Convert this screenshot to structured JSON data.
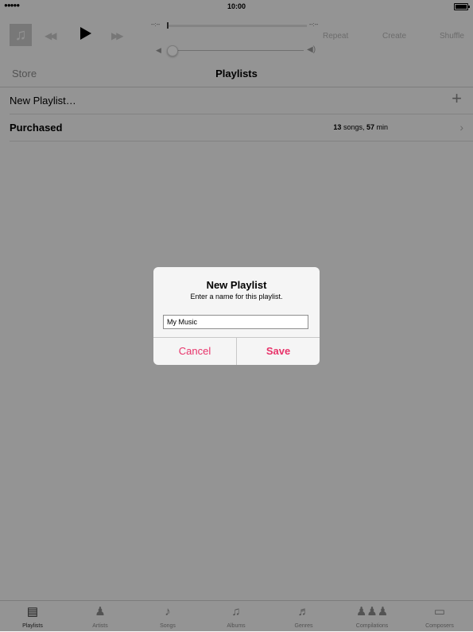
{
  "status_bar": {
    "signal": "●●●●●",
    "time": "10:00"
  },
  "player": {
    "elapsed": "--:--",
    "remaining": "--:--",
    "repeat_label": "Repeat",
    "create_label": "Create",
    "shuffle_label": "Shuffle"
  },
  "nav": {
    "store_label": "Store",
    "title": "Playlists"
  },
  "list": {
    "new_playlist_label": "New Playlist…",
    "purchased_label": "Purchased",
    "purchased_song_count": "13",
    "purchased_songs_text": " songs, ",
    "purchased_minutes": "57",
    "purchased_min_text": " min"
  },
  "tabs": [
    {
      "label": "Playlists",
      "icon": "playlists-icon"
    },
    {
      "label": "Artists",
      "icon": "artists-icon"
    },
    {
      "label": "Songs",
      "icon": "songs-icon"
    },
    {
      "label": "Albums",
      "icon": "albums-icon"
    },
    {
      "label": "Genres",
      "icon": "genres-icon"
    },
    {
      "label": "Compilations",
      "icon": "compilations-icon"
    },
    {
      "label": "Composers",
      "icon": "composers-icon"
    }
  ],
  "alert": {
    "title": "New Playlist",
    "message": "Enter a name for this playlist.",
    "input_value": "My Music",
    "cancel_label": "Cancel",
    "save_label": "Save"
  },
  "colors": {
    "accent": "#e8336a",
    "background": "#f7f7f7",
    "overlay": "rgba(0,0,0,0.4)"
  }
}
